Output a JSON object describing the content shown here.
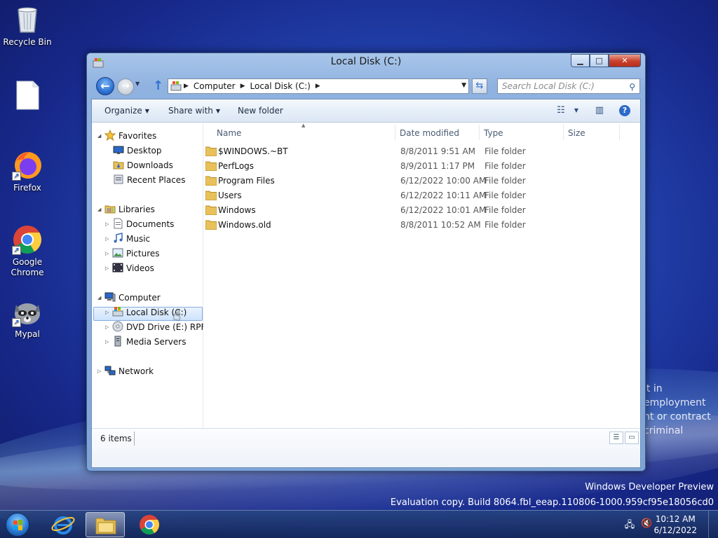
{
  "desktop": {
    "icons": [
      {
        "label": "Recycle Bin"
      },
      {
        "label": ""
      },
      {
        "label": "Firefox"
      },
      {
        "label": "Google Chrome"
      },
      {
        "label": "Mypal"
      }
    ],
    "wallpaper_text": [
      "lt in",
      "employment",
      "nt or contract",
      "criminal"
    ],
    "dev_preview_line1": "Windows Developer Preview",
    "dev_preview_line2": "Evaluation copy. Build 8064.fbl_eeap.110806-1000.959cf95e18056cd0"
  },
  "window": {
    "title": "Local Disk (C:)",
    "controls": {
      "minimize": "▁",
      "maximize": "□",
      "close": "✕"
    },
    "address": {
      "crumbs": [
        "Computer",
        "Local Disk (C:)"
      ]
    },
    "search": {
      "placeholder": "Search Local Disk (C:)"
    },
    "toolbar": {
      "organize": "Organize",
      "share_with": "Share with",
      "new_folder": "New folder",
      "help": "?"
    },
    "navpane": {
      "favorites": "Favorites",
      "desktop": "Desktop",
      "downloads": "Downloads",
      "recent_places": "Recent Places",
      "libraries": "Libraries",
      "documents": "Documents",
      "music": "Music",
      "pictures": "Pictures",
      "videos": "Videos",
      "computer": "Computer",
      "local_disk": "Local Disk (C:)",
      "dvd_drive": "DVD Drive (E:) RPFile",
      "media_servers": "Media Servers",
      "network": "Network"
    },
    "columns": {
      "name": "Name",
      "date_modified": "Date modified",
      "type": "Type",
      "size": "Size"
    },
    "files": [
      {
        "name": "$WINDOWS.~BT",
        "date": "8/8/2011 9:51 AM",
        "type": "File folder"
      },
      {
        "name": "PerfLogs",
        "date": "8/9/2011 1:17 PM",
        "type": "File folder"
      },
      {
        "name": "Program Files",
        "date": "6/12/2022 10:00 AM",
        "type": "File folder"
      },
      {
        "name": "Users",
        "date": "6/12/2022 10:11 AM",
        "type": "File folder"
      },
      {
        "name": "Windows",
        "date": "6/12/2022 10:01 AM",
        "type": "File folder"
      },
      {
        "name": "Windows.old",
        "date": "8/8/2011 10:52 AM",
        "type": "File folder"
      }
    ],
    "status": {
      "item_count": "6 items"
    }
  },
  "taskbar": {
    "clock_time": "10:12 AM",
    "clock_date": "6/12/2022"
  },
  "colors": {
    "folder": "#e8c15a",
    "accent": "#2c69c8"
  }
}
